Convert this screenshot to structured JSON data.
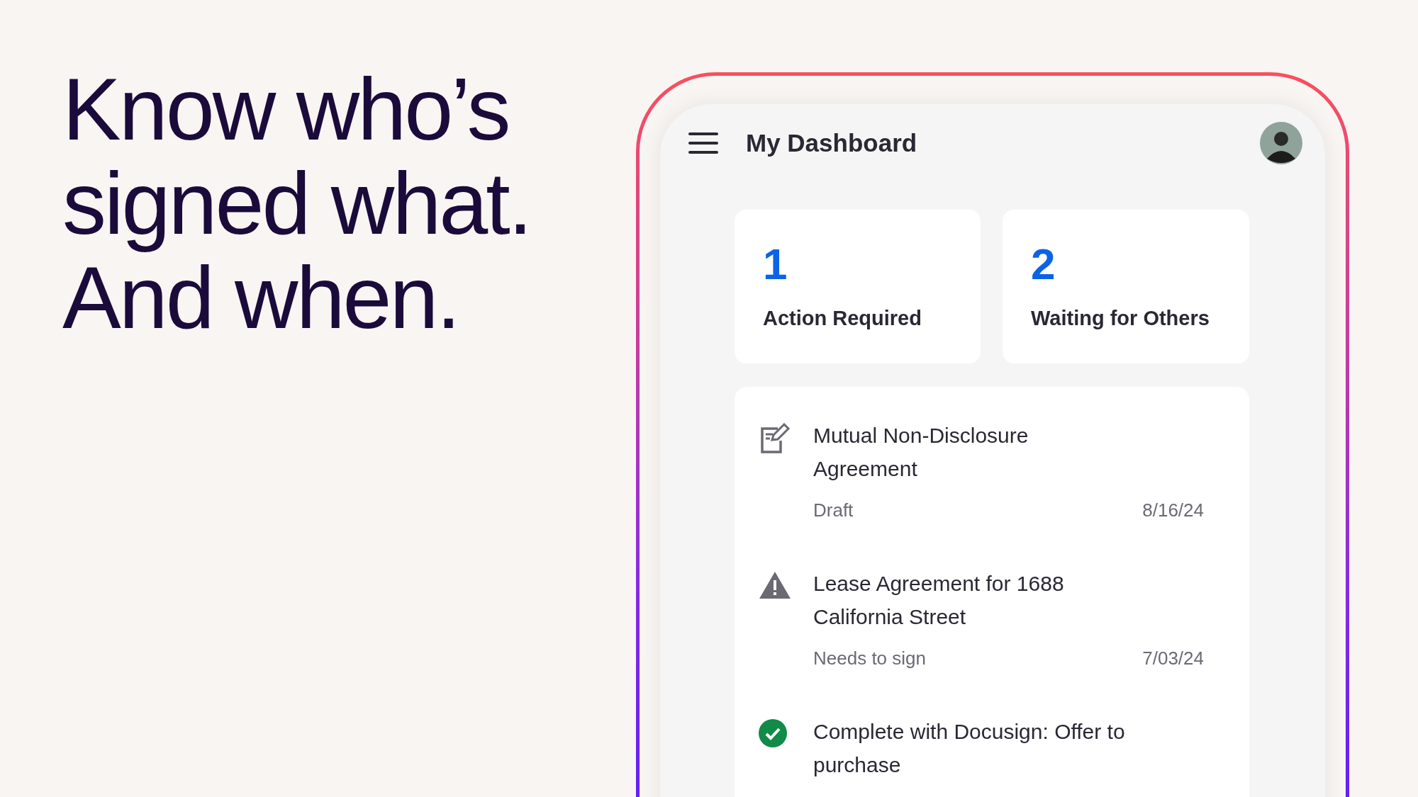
{
  "headline": [
    "Know who’s",
    "signed what.",
    "And when."
  ],
  "app": {
    "title": "My Dashboard",
    "summary_cards": [
      {
        "count": "1",
        "label": "Action Required"
      },
      {
        "count": "2",
        "label": "Waiting for Others"
      }
    ],
    "documents": [
      {
        "kind": "draft",
        "title_lines": [
          "Mutual Non-Disclosure",
          "Agreement"
        ],
        "status": "Draft",
        "date": "8/16/24"
      },
      {
        "kind": "needs_sign",
        "title_lines": [
          "Lease Agreement for 1688",
          "California Street"
        ],
        "status": "Needs to sign",
        "date": "7/03/24"
      },
      {
        "kind": "completed",
        "title_lines": [
          "Complete with Docusign: Offer to",
          "purchase"
        ]
      }
    ]
  }
}
